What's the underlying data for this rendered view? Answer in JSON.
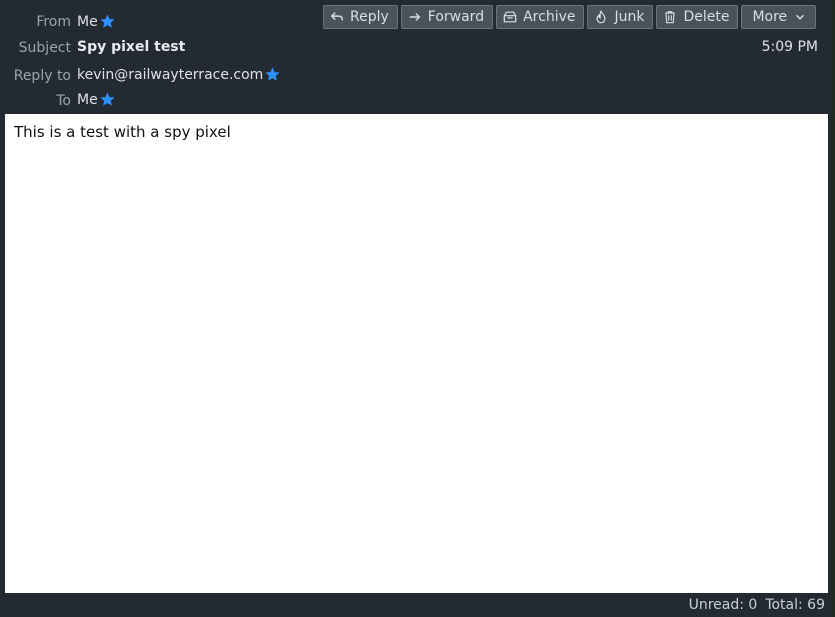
{
  "header": {
    "from_label": "From",
    "from_value": "Me",
    "subject_label": "Subject",
    "subject_value": "Spy pixel test",
    "reply_to_label": "Reply to",
    "reply_to_value": "kevin@railwayterrace.com",
    "to_label": "To",
    "to_value": "Me",
    "time": "5:09 PM"
  },
  "toolbar": {
    "reply_label": "Reply",
    "forward_label": "Forward",
    "archive_label": "Archive",
    "junk_label": "Junk",
    "delete_label": "Delete",
    "more_label": "More"
  },
  "message": {
    "body": "This is a test with a spy pixel"
  },
  "status": {
    "unread": "Unread: 0",
    "total": "Total: 69"
  },
  "colors": {
    "header_bg": "#242a32",
    "accent_star": "#2f8fff",
    "button_bg": "#4a525b"
  },
  "icons": [
    "star-icon",
    "reply-icon",
    "forward-icon",
    "archive-icon",
    "junk-icon",
    "delete-icon",
    "chevron-down-icon"
  ]
}
